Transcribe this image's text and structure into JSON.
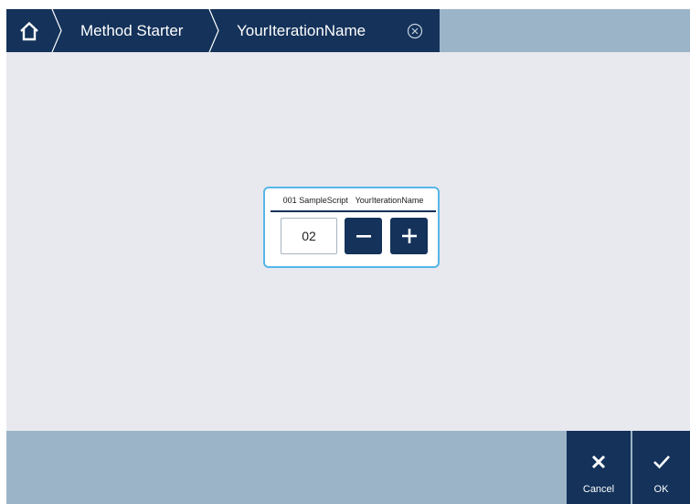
{
  "header": {
    "breadcrumbs": [
      {
        "label": "Method Starter"
      },
      {
        "label": "YourIterationName"
      }
    ]
  },
  "dialog": {
    "script_id": "001",
    "script_name": "SampleScript",
    "iteration_name": "YourIterationName",
    "value": "02"
  },
  "footer": {
    "cancel_label": "Cancel",
    "ok_label": "OK"
  },
  "icons": {
    "home": "home-icon",
    "close": "close-circle-icon",
    "minus": "minus-icon",
    "plus": "plus-icon",
    "cancel": "x-icon",
    "ok": "checkmark-icon"
  },
  "colors": {
    "header_dark": "#14325a",
    "bar_light": "#9cb4c8",
    "background": "#e8e8ef",
    "dialog_border": "#56b6e6"
  }
}
